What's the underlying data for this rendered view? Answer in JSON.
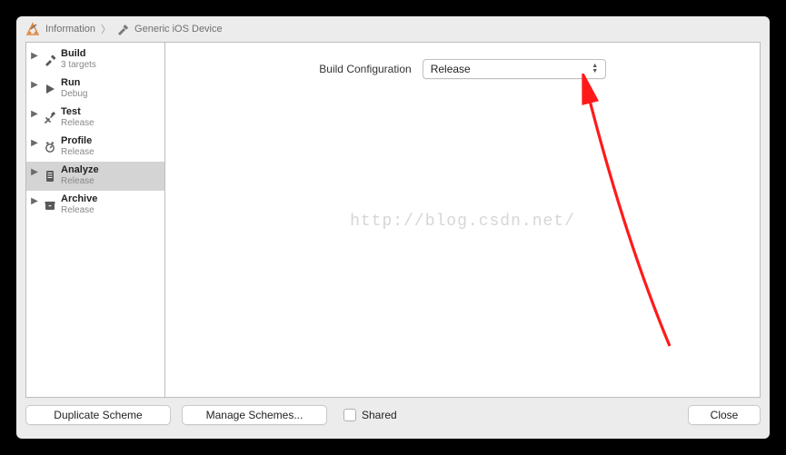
{
  "breadcrumb": {
    "project": "Information",
    "target": "Generic iOS Device"
  },
  "sidebar": {
    "items": [
      {
        "label": "Build",
        "sub": "3 targets"
      },
      {
        "label": "Run",
        "sub": "Debug"
      },
      {
        "label": "Test",
        "sub": "Release"
      },
      {
        "label": "Profile",
        "sub": "Release"
      },
      {
        "label": "Analyze",
        "sub": "Release"
      },
      {
        "label": "Archive",
        "sub": "Release"
      }
    ],
    "selected_index": 4
  },
  "main": {
    "build_config_label": "Build Configuration",
    "build_config_value": "Release"
  },
  "footer": {
    "duplicate": "Duplicate Scheme",
    "manage": "Manage Schemes...",
    "shared_label": "Shared",
    "shared_checked": false,
    "close": "Close"
  },
  "watermark": "http://blog.csdn.net/",
  "colors": {
    "accent_red": "#ff1a1a",
    "selection_bg": "#d4d4d4"
  }
}
